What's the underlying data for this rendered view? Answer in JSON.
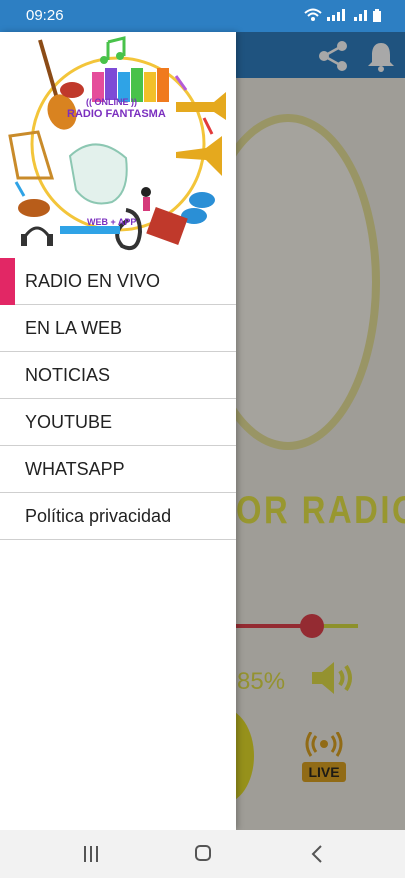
{
  "status_bar": {
    "time": "09:26"
  },
  "background_app": {
    "brand_text": "OR RADIO",
    "volume_label": "85%",
    "volume_level": 0.85,
    "live_label": "LIVE"
  },
  "drawer": {
    "logo": {
      "badge": "(( ONLINE ))",
      "title": "RADIO FANTASMA",
      "subtitle": "WEB + APP"
    },
    "items": [
      {
        "label": "RADIO EN VIVO"
      },
      {
        "label": "EN LA WEB"
      },
      {
        "label": "NOTICIAS"
      },
      {
        "label": "YOUTUBE"
      },
      {
        "label": "WHATSAPP"
      },
      {
        "label": "Política privacidad"
      }
    ]
  },
  "colors": {
    "status_bar": "#2d7fc3",
    "active_indicator": "#e22765",
    "accent_yellow": "#e7e64a",
    "slider_red": "#e1424d"
  }
}
